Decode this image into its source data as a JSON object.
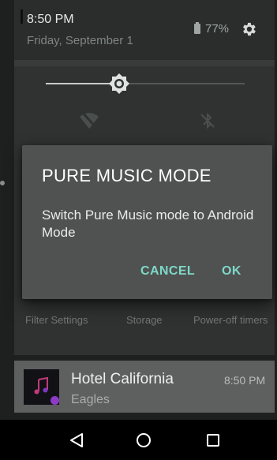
{
  "status": {
    "time": "8:50 PM",
    "date": "Friday, September 1",
    "battery": "77%"
  },
  "quick_settings": {
    "brightness_level": 0.37,
    "icons": [
      "brightness-icon",
      "wifi-off-icon",
      "bluetooth-off-icon",
      "gear-icon"
    ]
  },
  "dialog": {
    "title": "PURE MUSIC MODE",
    "message": "Switch Pure Music mode to Android Mode",
    "cancel_label": "CANCEL",
    "ok_label": "OK",
    "accent_color": "#7fd8c9"
  },
  "settings_row": {
    "filter": "Filter Settings",
    "storage": "Storage",
    "timers": "Power-off timers"
  },
  "notification": {
    "title": "Hotel California",
    "artist": "Eagles",
    "time": "8:50 PM",
    "badge_color": "#8e3ac9"
  },
  "navbar": {
    "icons": [
      "back-icon",
      "home-icon",
      "recents-icon"
    ]
  }
}
